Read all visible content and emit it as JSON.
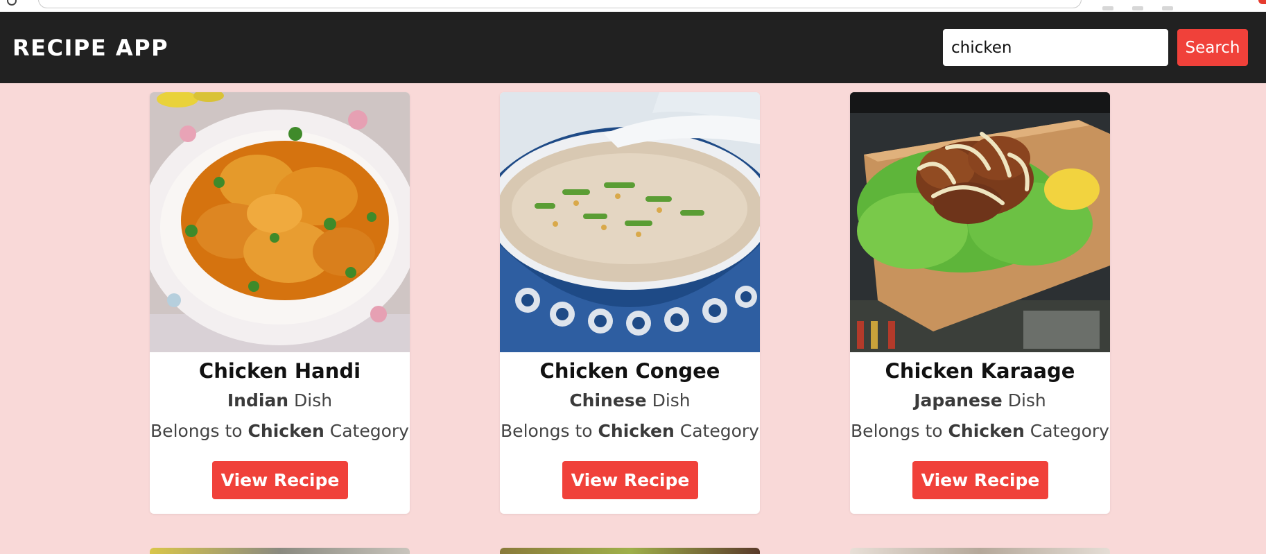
{
  "app": {
    "title": "RECIPE APP"
  },
  "search": {
    "value": "chicken",
    "button_label": "Search"
  },
  "colors": {
    "header_bg": "#212121",
    "accent": "#f0413a",
    "page_bg": "#f9d9d8"
  },
  "recipes": [
    {
      "name": "Chicken Handi",
      "area": "Indian",
      "area_suffix": " Dish",
      "category_prefix": "Belongs to ",
      "category": "Chicken",
      "category_suffix": " Category",
      "button_label": "View Recipe",
      "image_icon": "chicken-curry-photo"
    },
    {
      "name": "Chicken Congee",
      "area": "Chinese",
      "area_suffix": " Dish",
      "category_prefix": "Belongs to ",
      "category": "Chicken",
      "category_suffix": " Category",
      "button_label": "View Recipe",
      "image_icon": "congee-bowl-photo"
    },
    {
      "name": "Chicken Karaage",
      "area": "Japanese",
      "area_suffix": " Dish",
      "category_prefix": "Belongs to ",
      "category": "Chicken",
      "category_suffix": " Category",
      "button_label": "View Recipe",
      "image_icon": "karaage-board-photo"
    }
  ]
}
